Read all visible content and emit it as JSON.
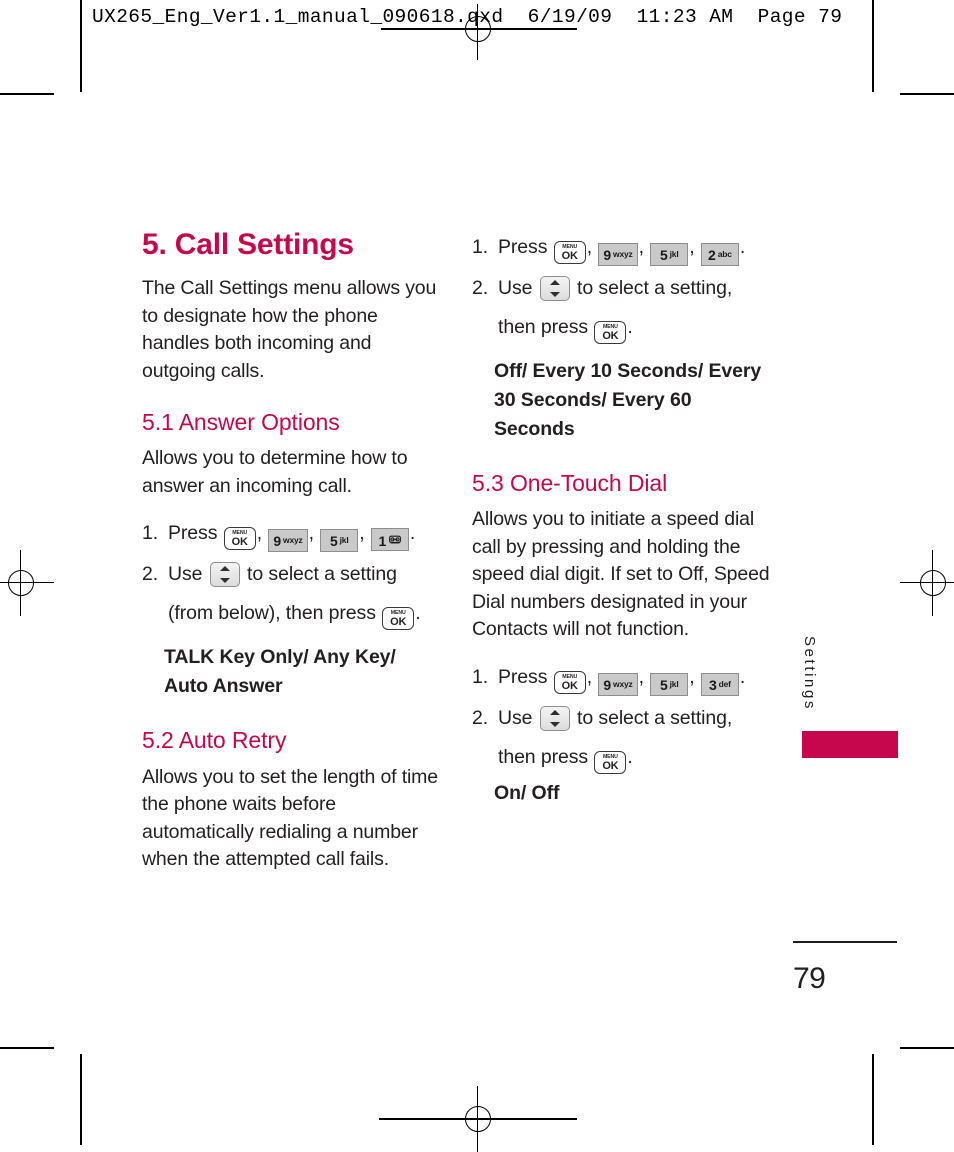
{
  "print_header": "UX265_Eng_Ver1.1_manual_090618.qxd  6/19/09  11:23 AM  Page 79",
  "accent_color": "#c6074e",
  "text_color": "#231f20",
  "side_tab": {
    "label": "Settings"
  },
  "footer": {
    "page_number": "79"
  },
  "keys": {
    "menu_top": "MENU",
    "menu_bottom": "OK",
    "nine_num": "9",
    "nine_letters": "wxyz",
    "five_num": "5",
    "five_letters": "jkl",
    "one_num": "1",
    "one_letters": "voicemail-symbol",
    "two_num": "2",
    "two_letters": "abc",
    "three_num": "3",
    "three_letters": "def",
    "nav_icon": "up-down-arrows"
  },
  "left_column": {
    "chapter_title": "5. Call Settings",
    "chapter_intro": "The Call Settings menu allows you to designate how the phone handles both incoming and outgoing calls.",
    "section_51": {
      "heading": "5.1 Answer Options",
      "body": "Allows you to determine how to answer an incoming call.",
      "step1_num": "1.",
      "step1_pre": "Press",
      "step1_comma": ",",
      "step1_end": ".",
      "step2_num": "2.",
      "step2_pre": "Use",
      "step2_mid": "to select a setting",
      "step2_cont": "(from below), then press",
      "step2_end": ".",
      "options": "TALK Key Only/ Any Key/ Auto Answer"
    },
    "section_52": {
      "heading": "5.2 Auto Retry",
      "body": "Allows you to set the length of time the phone waits before automatically redialing a number when the attempted call fails."
    }
  },
  "right_column": {
    "section_52_steps": {
      "step1_num": "1.",
      "step1_pre": "Press",
      "step1_comma": ",",
      "step1_end": ".",
      "step2_num": "2.",
      "step2_pre": "Use",
      "step2_mid": "to select a setting,",
      "step2_cont": "then press",
      "step2_end": ".",
      "options": "Off/ Every 10 Seconds/ Every 30 Seconds/ Every 60 Seconds"
    },
    "section_53": {
      "heading": "5.3 One-Touch Dial",
      "body": "Allows you to initiate a speed dial call by pressing and holding the speed dial digit. If set to Off, Speed Dial numbers designated in your Contacts will not function.",
      "step1_num": "1.",
      "step1_pre": "Press",
      "step1_comma": ",",
      "step1_end": ".",
      "step2_num": "2.",
      "step2_pre": "Use",
      "step2_mid": "to select a setting,",
      "step2_cont": "then press",
      "step2_end": ".",
      "options": "On/ Off"
    }
  }
}
